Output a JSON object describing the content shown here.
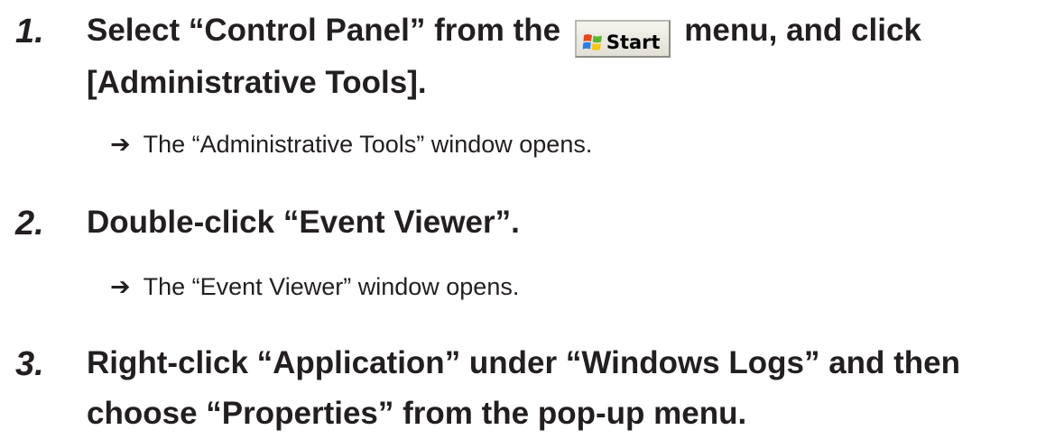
{
  "steps": [
    {
      "number": "1.",
      "line1_before": "Select “Control Panel” from the",
      "start_button_label": "Start",
      "start_icon": "windows-logo-icon",
      "line1_after": "menu, and click",
      "line2": "[Administrative Tools].",
      "result_arrow": "➔",
      "result": "The “Administrative Tools” window opens."
    },
    {
      "number": "2.",
      "line1": "Double-click “Event Viewer”.",
      "result_arrow": "➔",
      "result": "The “Event Viewer” window opens."
    },
    {
      "number": "3.",
      "line1": "Right-click “Application” under “Windows Logs” and then",
      "line2": "choose “Properties” from the pop-up menu."
    }
  ]
}
